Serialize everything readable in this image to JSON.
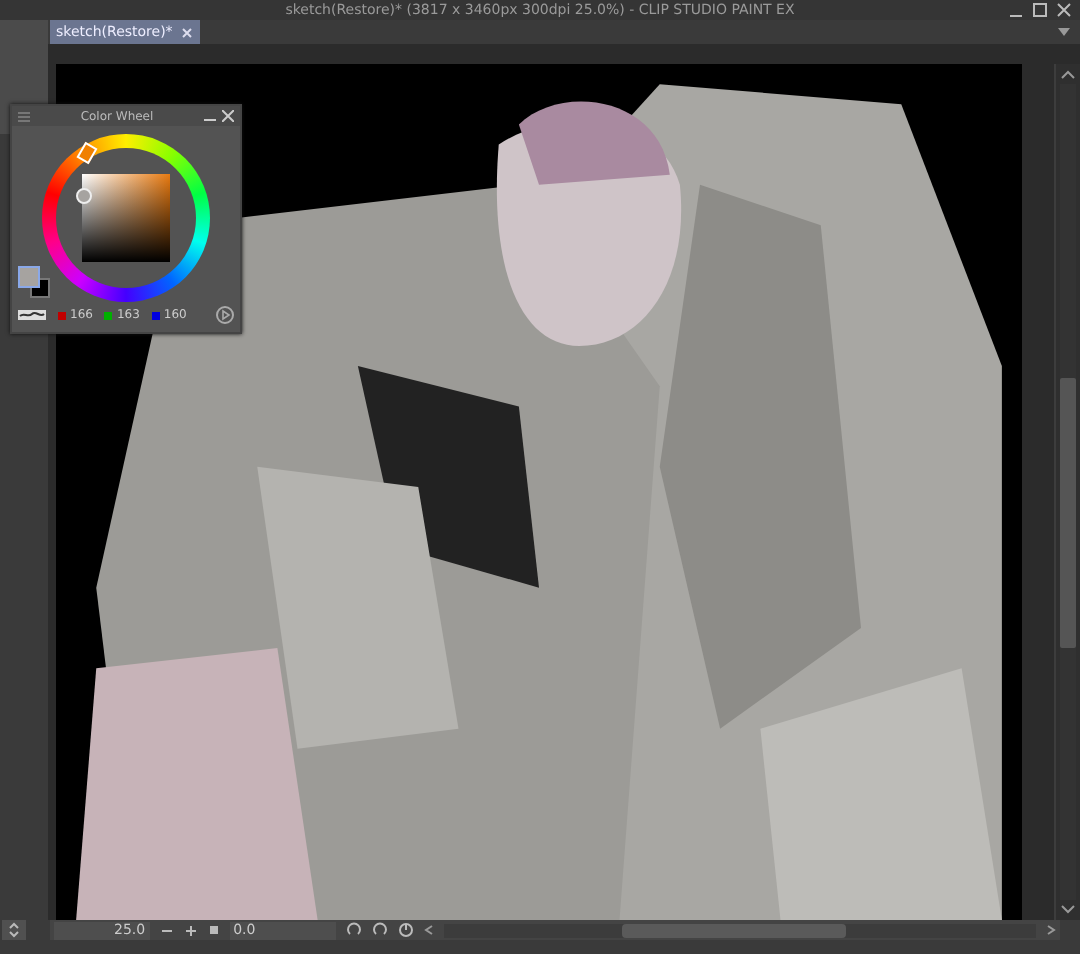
{
  "window": {
    "title": "sketch(Restore)* (3817 x 3460px 300dpi 25.0%) - CLIP STUDIO PAINT EX"
  },
  "tabs": [
    {
      "label": "sketch(Restore)*",
      "selected": true
    }
  ],
  "color_wheel": {
    "title": "Color Wheel",
    "red": "166",
    "green": "163",
    "blue": "160"
  },
  "navigator": {
    "zoom": "25.0",
    "rotation": "0.0"
  }
}
